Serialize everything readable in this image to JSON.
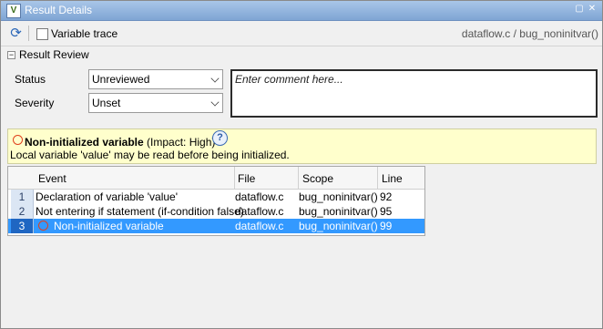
{
  "window": {
    "title": "Result Details",
    "app_icon": "V"
  },
  "toolbar": {
    "variable_trace_label": "Variable trace",
    "variable_trace_checked": false,
    "location": "dataflow.c / bug_noninitvar()"
  },
  "review": {
    "section_title": "Result Review",
    "status_label": "Status",
    "status_value": "Unreviewed",
    "severity_label": "Severity",
    "severity_value": "Unset",
    "comment_placeholder": "Enter comment here..."
  },
  "defect": {
    "name": "Non-initialized variable",
    "impact": "(Impact: High)",
    "description": "Local variable 'value' may be read before being initialized.",
    "accent_color": "#e0421c"
  },
  "events": {
    "columns": [
      "Event",
      "File",
      "Scope",
      "Line"
    ],
    "rows": [
      {
        "num": "1",
        "event": "Declaration of variable 'value'",
        "file": "dataflow.c",
        "scope": "bug_noninitvar()",
        "line": "92"
      },
      {
        "num": "2",
        "event": "Not entering if statement (if-condition false)",
        "file": "dataflow.c",
        "scope": "bug_noninitvar()",
        "line": "95"
      },
      {
        "num": "3",
        "event": "Non-initialized variable",
        "file": "dataflow.c",
        "scope": "bug_noninitvar()",
        "line": "99",
        "selected": true
      }
    ]
  }
}
